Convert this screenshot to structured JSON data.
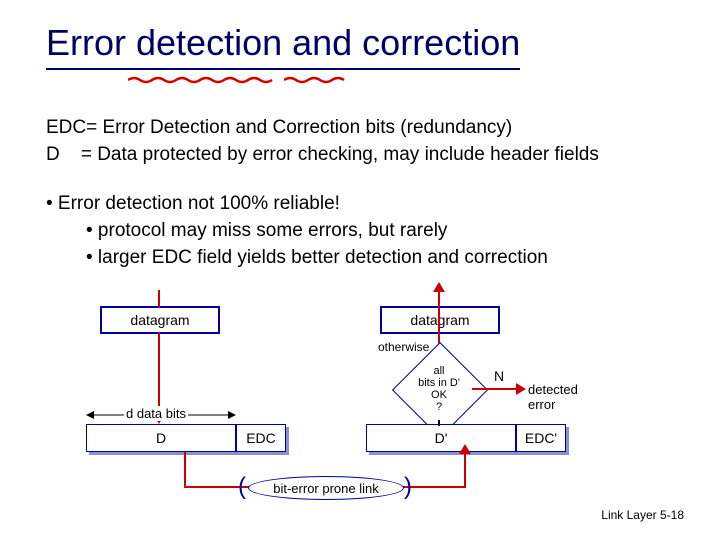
{
  "title": "Error detection and correction",
  "definitions": {
    "line1": "EDC= Error Detection and Correction bits (redundancy)",
    "line2": "D    = Data protected by error checking, may include header fields"
  },
  "bullets": {
    "b1": "• Error detection not 100% reliable!",
    "b2": "• protocol may miss some errors, but rarely",
    "b3": "• larger EDC field yields better detection and correction"
  },
  "diagram": {
    "datagram_left": "datagram",
    "datagram_right": "datagram",
    "otherwise": "otherwise",
    "diamond_l1": "all",
    "diamond_l2": "bits in D'",
    "diamond_l3": "OK",
    "diamond_l4": "?",
    "n_label": "N",
    "detected": "detected",
    "error": "error",
    "d_bits": "d data bits",
    "D": "D",
    "EDC": "EDC",
    "Dp": "D'",
    "EDCp": "EDC'",
    "link": "bit-error prone link"
  },
  "footer": "Link Layer  5-18"
}
